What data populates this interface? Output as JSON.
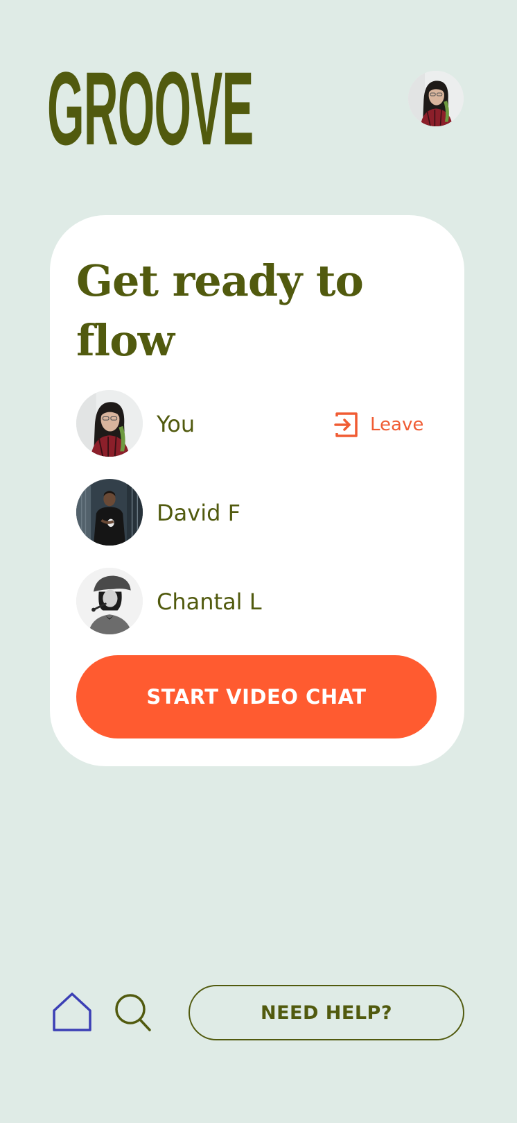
{
  "header": {
    "logo_text": "GROOVE",
    "profile_avatar": "avatar-you"
  },
  "card": {
    "title": "Get ready to flow",
    "participants": [
      {
        "name": "You",
        "avatar": "avatar-you"
      },
      {
        "name": "David F",
        "avatar": "avatar-david"
      },
      {
        "name": "Chantal L",
        "avatar": "avatar-chantal"
      }
    ],
    "leave_label": "Leave",
    "leave_icon": "leave-icon",
    "start_button_label": "START VIDEO CHAT"
  },
  "bottom_nav": {
    "home_icon": "home-icon",
    "search_icon": "search-icon",
    "help_button_label": "NEED HELP?"
  },
  "colors": {
    "background": "#dfebe6",
    "brand_olive": "#515a0e",
    "accent_orange": "#ff5b30",
    "leave_orange": "#f05c33",
    "home_icon_blue": "#3b3fb5",
    "card": "#ffffff"
  }
}
